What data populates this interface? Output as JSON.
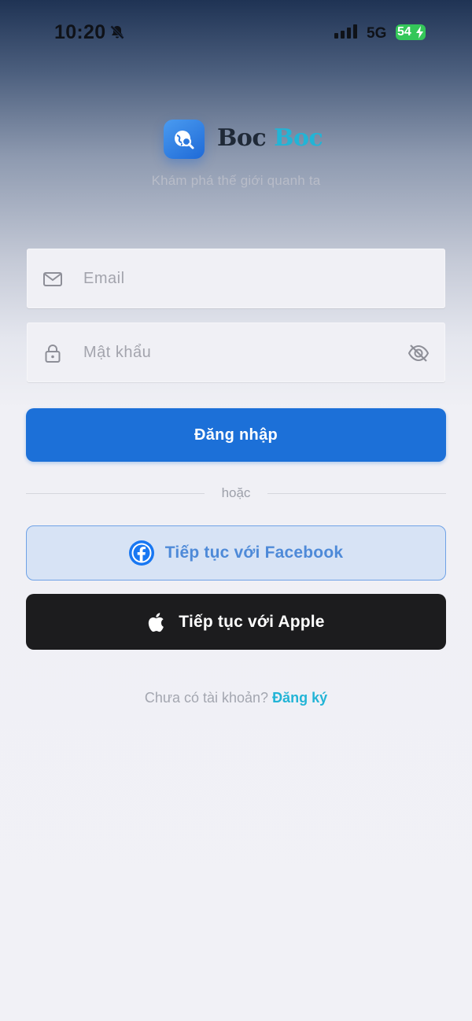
{
  "status_bar": {
    "time": "10:20",
    "network": "5G",
    "battery": "54"
  },
  "brand": {
    "word1": "Boc",
    "word2": "Boc",
    "tagline": "Khám phá thế giới quanh ta"
  },
  "form": {
    "email": {
      "placeholder": "Email",
      "value": ""
    },
    "password": {
      "placeholder": "Mật khẩu",
      "value": ""
    },
    "login_label": "Đăng nhập"
  },
  "divider_text": "hoặc",
  "social": {
    "facebook_label": "Tiếp tục với Facebook",
    "apple_label": "Tiếp tục với Apple"
  },
  "footer": {
    "prompt": "Chưa có tài khoản?",
    "signup_label": "Đăng ký"
  },
  "colors": {
    "primary": "#1c70d8",
    "accent": "#22b4d6",
    "facebook": "#1877f2",
    "apple_bg": "#1c1c1e"
  },
  "icons": {
    "bell": "bell-slash-icon",
    "signal": "cellular-signal-icon",
    "battery": "battery-charging-icon",
    "logo": "globe-search-icon",
    "email": "mail-icon",
    "password": "lock-icon",
    "toggle": "eye-off-icon",
    "facebook": "facebook-icon",
    "apple": "apple-icon"
  }
}
